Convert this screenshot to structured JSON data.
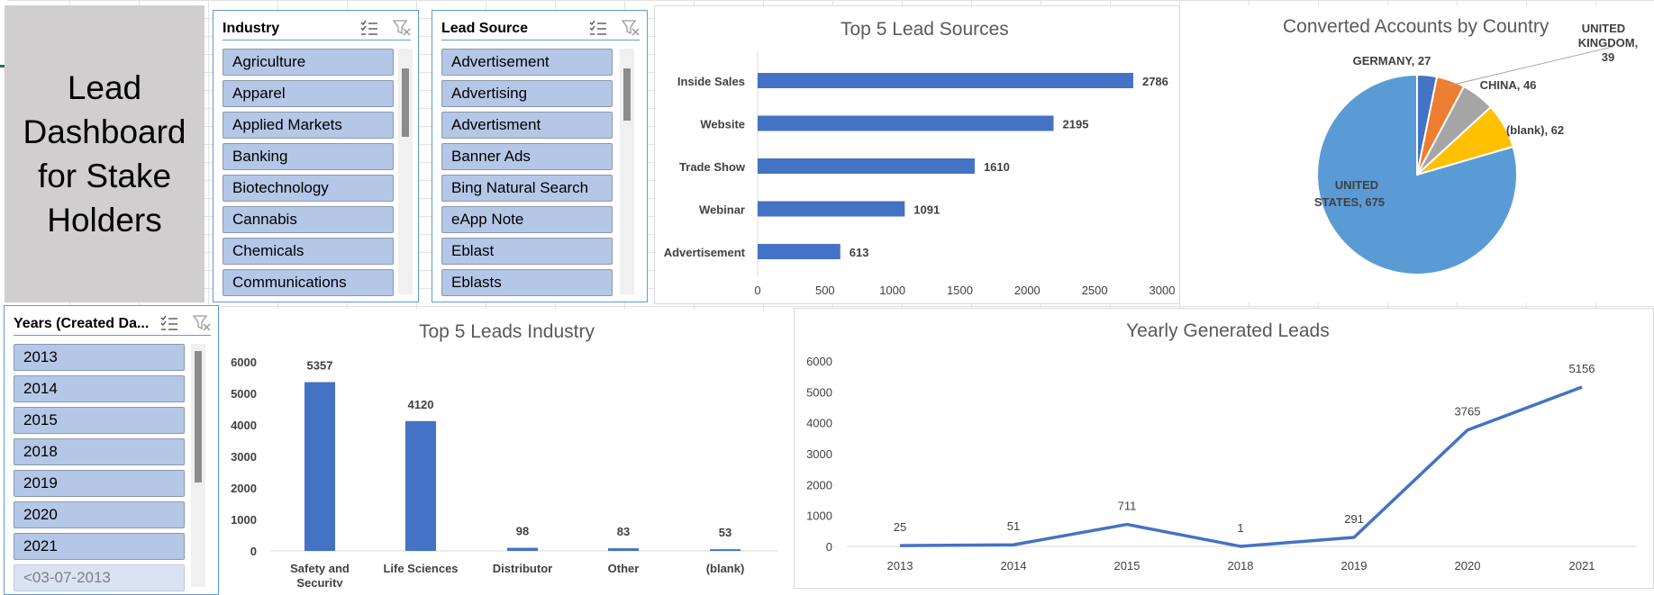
{
  "title": "Lead\nDashboard\nfor Stake\nHolders",
  "slicers": {
    "industry": {
      "title": "Industry",
      "items": [
        "Agriculture",
        "Apparel",
        "Applied Markets",
        "Banking",
        "Biotechnology",
        "Cannabis",
        "Chemicals",
        "Communications"
      ]
    },
    "lead_source": {
      "title": "Lead Source",
      "items": [
        "Advertisement",
        "Advertising",
        "Advertisment",
        "Banner Ads",
        "Bing Natural Search",
        "eApp Note",
        "Eblast",
        "Eblasts"
      ]
    },
    "years": {
      "title": "Years (Created Da...",
      "items": [
        "2013",
        "2014",
        "2015",
        "2018",
        "2019",
        "2020",
        "2021",
        "<03-07-2013"
      ]
    }
  },
  "icons": {
    "multiselect": "multi-select-icon",
    "clear_filter": "clear-filter-icon"
  },
  "colors": {
    "bar": "#4472c4",
    "slicer_item": "#b4c7e7",
    "slicer_border": "#5b9bd5",
    "title_box": "#d0cece"
  },
  "chart_data": [
    {
      "id": "lead_sources",
      "type": "bar",
      "orientation": "horizontal",
      "title": "Top 5 Lead Sources",
      "categories": [
        "Inside Sales",
        "Website",
        "Trade Show",
        "Webinar",
        "Advertisement"
      ],
      "values": [
        2786,
        2195,
        1610,
        1091,
        613
      ],
      "xlim": [
        0,
        3000
      ],
      "ticks": [
        "0",
        "500",
        "1000",
        "1500",
        "2000",
        "2500",
        "3000"
      ],
      "grid": false
    },
    {
      "id": "country_pie",
      "type": "pie",
      "title": "Converted Accounts by Country",
      "slices": [
        {
          "name": "GERMANY",
          "value": 27,
          "label": "GERMANY, 27",
          "color": "#4472c4"
        },
        {
          "name": "UNITED KINGDOM",
          "value": 39,
          "label": "UNITED KINGDOM, 39",
          "color": "#ed7d31"
        },
        {
          "name": "CHINA",
          "value": 46,
          "label": "CHINA, 46",
          "color": "#a5a5a5"
        },
        {
          "name": "(blank)",
          "value": 62,
          "label": "(blank), 62",
          "color": "#ffc000"
        },
        {
          "name": "UNITED STATES",
          "value": 675,
          "label": "UNITED STATES, 675",
          "color": "#5b9bd5"
        }
      ]
    },
    {
      "id": "industry",
      "type": "bar",
      "orientation": "vertical",
      "title": "Top 5 Leads Industry",
      "categories": [
        "Safety and Security",
        "Life Sciences",
        "Distributor",
        "Other",
        "(blank)"
      ],
      "values": [
        5357,
        4120,
        98,
        83,
        53
      ],
      "ylim": [
        0,
        6000
      ],
      "ticks": [
        "0",
        "1000",
        "2000",
        "3000",
        "4000",
        "5000",
        "6000"
      ],
      "grid": false
    },
    {
      "id": "yearly",
      "type": "line",
      "title": "Yearly Generated Leads",
      "categories": [
        "2013",
        "2014",
        "2015",
        "2018",
        "2019",
        "2020",
        "2021"
      ],
      "values": [
        25,
        51,
        711,
        1,
        291,
        3765,
        5156
      ],
      "ylim": [
        0,
        6000
      ],
      "ticks": [
        "0",
        "1000",
        "2000",
        "3000",
        "4000",
        "5000",
        "6000"
      ],
      "grid": false
    }
  ]
}
